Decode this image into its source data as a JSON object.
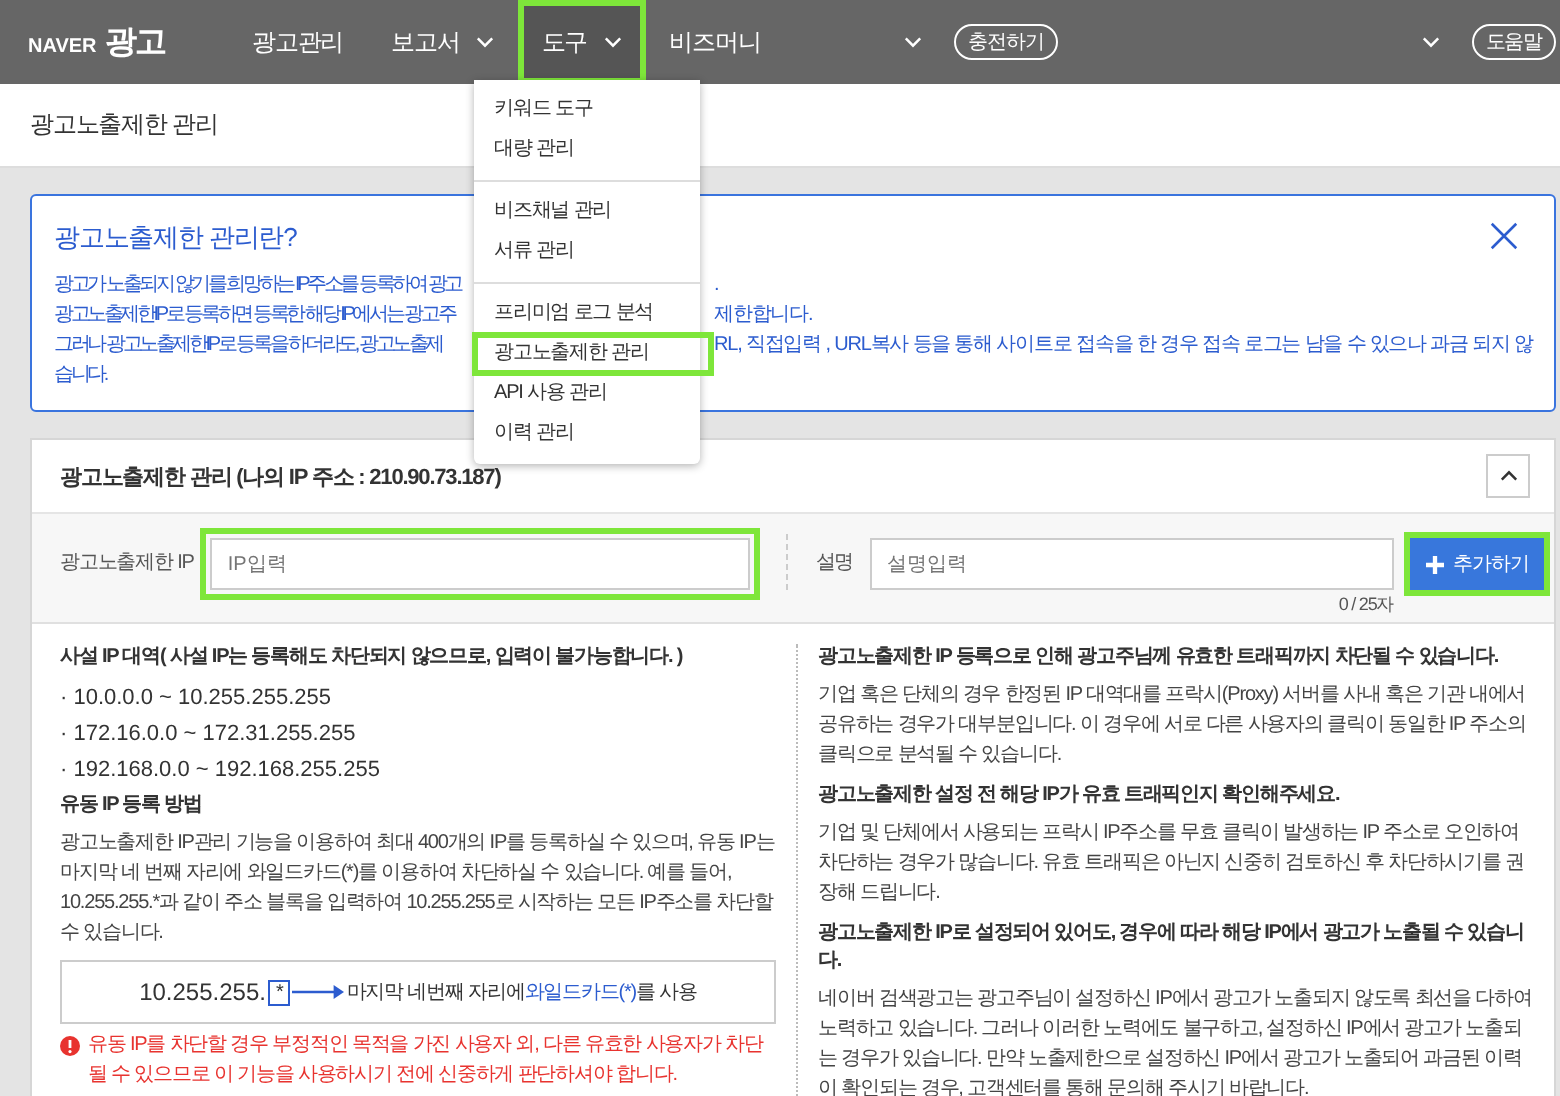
{
  "nav": {
    "logo_brand": "NAVER",
    "logo_text": "광고",
    "items": [
      {
        "label": "광고관리",
        "dropdown": false,
        "selected": false,
        "highlighted": false
      },
      {
        "label": "보고서",
        "dropdown": true,
        "selected": false,
        "highlighted": false
      },
      {
        "label": "도구",
        "dropdown": true,
        "selected": true,
        "highlighted": true
      },
      {
        "label": "비즈머니",
        "dropdown": false,
        "selected": false,
        "highlighted": false
      }
    ],
    "charge_button": "충전하기",
    "help_button": "도움말"
  },
  "page_title": "광고노출제한 관리",
  "dropdown_menu": {
    "groups": [
      [
        {
          "label": "키워드 도구",
          "highlighted": false
        },
        {
          "label": "대량 관리",
          "highlighted": false
        }
      ],
      [
        {
          "label": "비즈채널 관리",
          "highlighted": false
        },
        {
          "label": "서류 관리",
          "highlighted": false
        }
      ],
      [
        {
          "label": "프리미엄 로그 분석",
          "highlighted": false
        },
        {
          "label": "광고노출제한 관리",
          "highlighted": true
        },
        {
          "label": "API 사용 관리",
          "highlighted": false
        },
        {
          "label": "이력 관리",
          "highlighted": false
        }
      ]
    ]
  },
  "info_box": {
    "title": "광고노출제한 관리란?",
    "lines": [
      {
        "left": "광고가 노출되지 않기를 희망하는 IP주소를 등록하여 광고",
        "right": "."
      },
      {
        "left": "광고노출제한IP로 등록하면 등록한 해당 IP에서는 광고주",
        "right": "제한합니다."
      },
      {
        "left": "그러나 광고노출제한IP로 등록을 하더라도, 광고노출제",
        "right": "RL, 직접입력 , URL복사 등을 통해 사이트로 접속을 한 경우 접속 로그는 남을 수 있으나 과금 되지 않"
      },
      {
        "left": "습니다."
      }
    ]
  },
  "panel": {
    "title": "광고노출제한 관리 (나의 IP 주소 : 210.90.73.187)",
    "expanded": true,
    "ip_label": "광고노출제한 IP",
    "ip_placeholder": "IP입력",
    "ip_highlighted": true,
    "desc_label": "설명",
    "desc_placeholder": "설명입력",
    "counter": "0 / 25자",
    "add_button": {
      "label": "추가하기",
      "highlighted": true
    },
    "private_heading": "사설 IP 대역( 사설 IP는 등록해도 차단되지 않으므로, 입력이 불가능합니다. )",
    "private_ranges": [
      "· 10.0.0.0 ~ 10.255.255.255",
      "· 172.16.0.0 ~ 172.31.255.255",
      "· 192.168.0.0 ~ 192.168.255.255"
    ],
    "dynamic_heading": "유동 IP 등록 방법",
    "dynamic_text": "광고노출제한 IP관리 기능을 이용하여 최대 400개의 IP를 등록하실 수 있으며, 유동 IP는 마지막 네 번째 자리에 와일드카드(*)를 이용하여 차단하실 수 있습니다. 예를 들어, 10.255.255.*과 같이 주소 블록을 입력하여 10.255.255로 시작하는 모든 IP주소를 차단할 수 있습니다.",
    "example": {
      "ip": "10.255.255.",
      "wildcard": "*",
      "caption_before": "마지막 네번째 자리에",
      "caption_highlight": "와일드카드(*)",
      "caption_after": "를 사용"
    },
    "warning": "유동 IP를 차단할 경우 부정적인 목적을 가진 사용자 외, 다른 유효한 사용자가 차단될 수 있으므로 이 기능을 사용하시기 전에 신중하게 판단하셔야 합니다.",
    "notes": [
      {
        "heading": "광고노출제한 IP 등록으로 인해 광고주님께 유효한 트래픽까지 차단될 수 있습니다.",
        "text": "기업 혹은 단체의 경우 한정된 IP 대역대를 프락시(Proxy) 서버를 사내 혹은 기관 내에서 공유하는 경우가 대부분입니다. 이 경우에 서로 다른 사용자의 클릭이 동일한 IP 주소의 클릭으로 분석될 수 있습니다."
      },
      {
        "heading": "광고노출제한 설정 전 해당 IP가 유효 트래픽인지 확인해주세요.",
        "text": "기업 및 단체에서 사용되는 프락시 IP주소를 무효 클릭이 발생하는 IP 주소로 오인하여 차단하는 경우가 많습니다. 유효 트래픽은 아닌지 신중히 검토하신 후 차단하시기를 권장해 드립니다."
      },
      {
        "heading": "광고노출제한 IP로 설정되어 있어도, 경우에 따라 해당 IP에서 광고가 노출될 수 있습니다.",
        "text": "네이버 검색광고는 광고주님이 설정하신 IP에서 광고가 노출되지 않도록 최선을 다하여 노력하고 있습니다. 그러나 이러한 노력에도 불구하고, 설정하신 IP에서 광고가 노출되는 경우가 있습니다. 만약 노출제한으로 설정하신 IP에서 광고가 노출되어 과금된 이력이 확인되는 경우, 고객센터를 통해 문의해 주시기 바랍니다."
      }
    ]
  }
}
